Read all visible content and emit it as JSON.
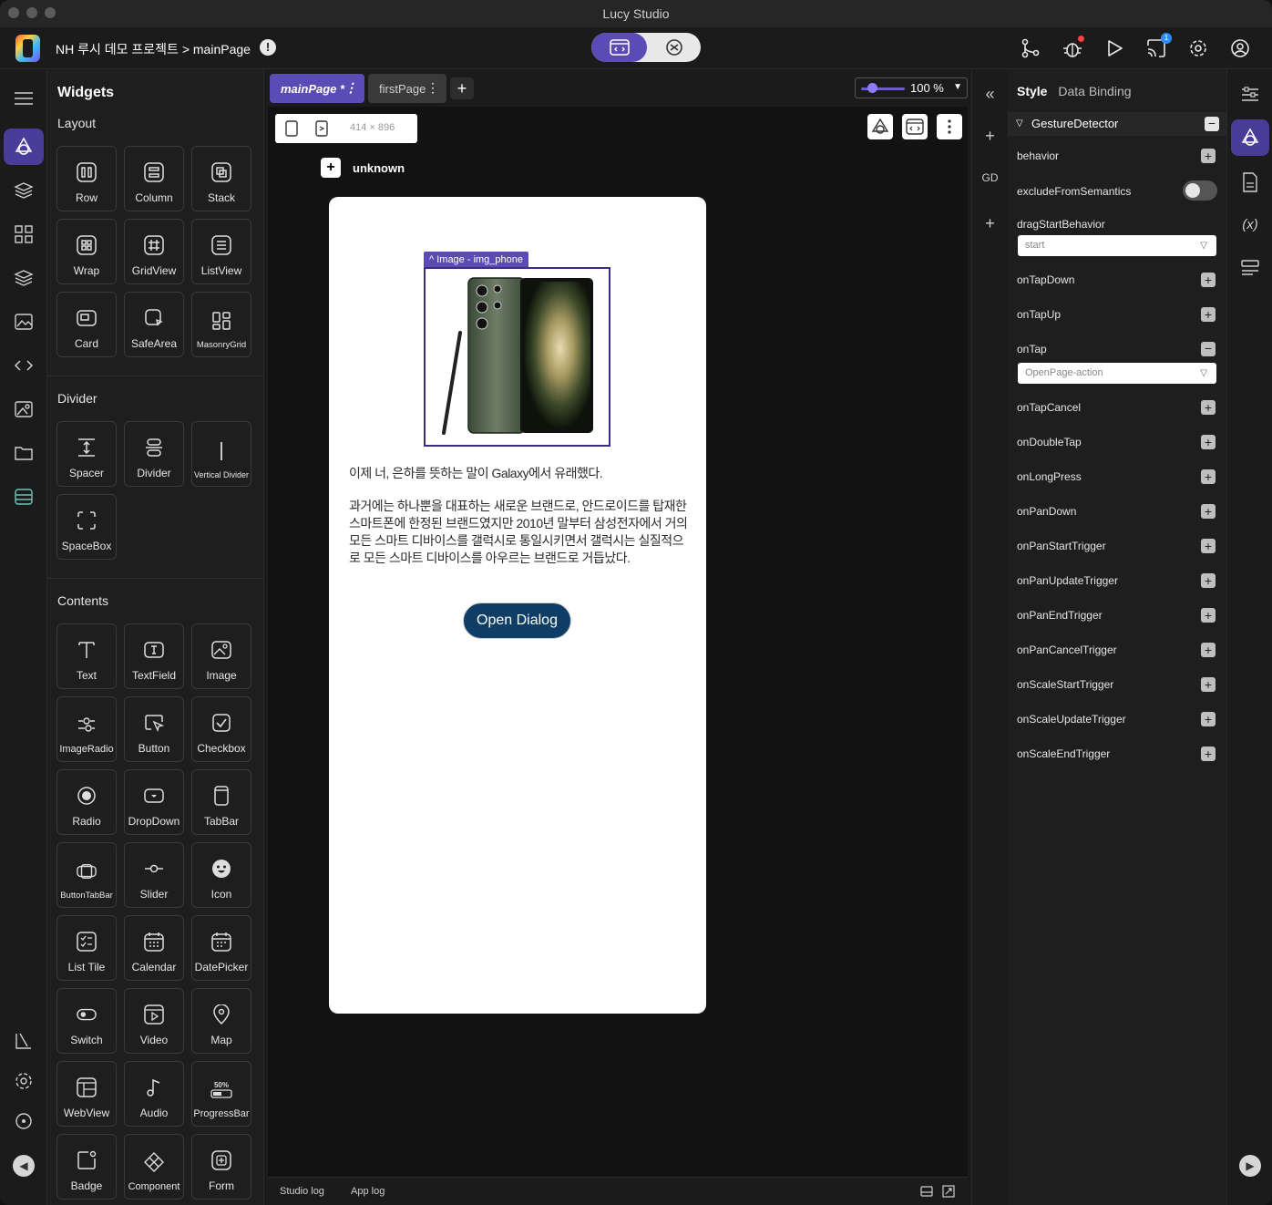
{
  "window": {
    "title": "Lucy Studio"
  },
  "header": {
    "project_path": "NH 루시 데모 프로젝트 > mainPage",
    "warning_icon": "warning-icon",
    "notification_count": "1"
  },
  "widgets_panel": {
    "title": "Widgets",
    "sections": {
      "layout": {
        "title": "Layout",
        "items": [
          "Row",
          "Column",
          "Stack",
          "Wrap",
          "GridView",
          "ListView",
          "Card",
          "SafeArea",
          "MasonryGrid"
        ]
      },
      "divider": {
        "title": "Divider",
        "items": [
          "Spacer",
          "Divider",
          "Vertical Divider",
          "SpaceBox"
        ]
      },
      "contents": {
        "title": "Contents",
        "items": [
          "Text",
          "TextField",
          "Image",
          "ImageRadio",
          "Button",
          "Checkbox",
          "Radio",
          "DropDown",
          "TabBar",
          "ButtonTabBar",
          "Slider",
          "Icon",
          "List Tile",
          "Calendar",
          "DatePicker",
          "Switch",
          "Video",
          "Map",
          "WebView",
          "Audio",
          "ProgressBar",
          "Badge",
          "Component",
          "Form"
        ]
      }
    },
    "progressbar_icon_text": "50%"
  },
  "canvas": {
    "tabs": [
      {
        "label": "mainPage *"
      },
      {
        "label": "firstPage"
      }
    ],
    "zoom": "100 %",
    "device_size": "414 × 896",
    "breadcrumb_label": "unknown",
    "image_label": "Image - img_phone",
    "paragraph1": "이제 너, 은하를 뜻하는 말이 Galaxy에서 유래했다.",
    "paragraph2": "과거에는 하나뿐을 대표하는 새로운 브랜드로, 안드로이드를 탑재한 스마트폰에 한정된 브랜드였지만 2010년 말부터 삼성전자에서 거의 모든 스마트 디바이스를 갤럭시로 통일시키면서 갤럭시는 실질적으로 모든 스마트 디바이스를 아우르는 브랜드로 거듭났다.",
    "button_label": "Open Dialog",
    "log_tabs": [
      "Studio log",
      "App log"
    ]
  },
  "right_strip": {
    "gd_label": "GD"
  },
  "properties": {
    "tabs": {
      "style": "Style",
      "binding": "Data Binding"
    },
    "widget_name": "GestureDetector",
    "items": {
      "behavior": "behavior",
      "exclude": "excludeFromSemantics",
      "dragStart": "dragStartBehavior",
      "dragStartValue": "start",
      "onTapDown": "onTapDown",
      "onTapUp": "onTapUp",
      "onTap": "onTap",
      "onTapValue": "OpenPage-action",
      "onTapCancel": "onTapCancel",
      "onDoubleTap": "onDoubleTap",
      "onLongPress": "onLongPress",
      "onPanDown": "onPanDown",
      "onPanStartTrigger": "onPanStartTrigger",
      "onPanUpdateTrigger": "onPanUpdateTrigger",
      "onPanEndTrigger": "onPanEndTrigger",
      "onPanCancelTrigger": "onPanCancelTrigger",
      "onScaleStartTrigger": "onScaleStartTrigger",
      "onScaleUpdateTrigger": "onScaleUpdateTrigger",
      "onScaleEndTrigger": "onScaleEndTrigger"
    },
    "excludeFromSemantics_on": false
  },
  "colors": {
    "accent": "#5b4bb5",
    "button_bg": "#0e3d66",
    "badge": "#2f8cff",
    "alert_dot": "#ff4040"
  }
}
